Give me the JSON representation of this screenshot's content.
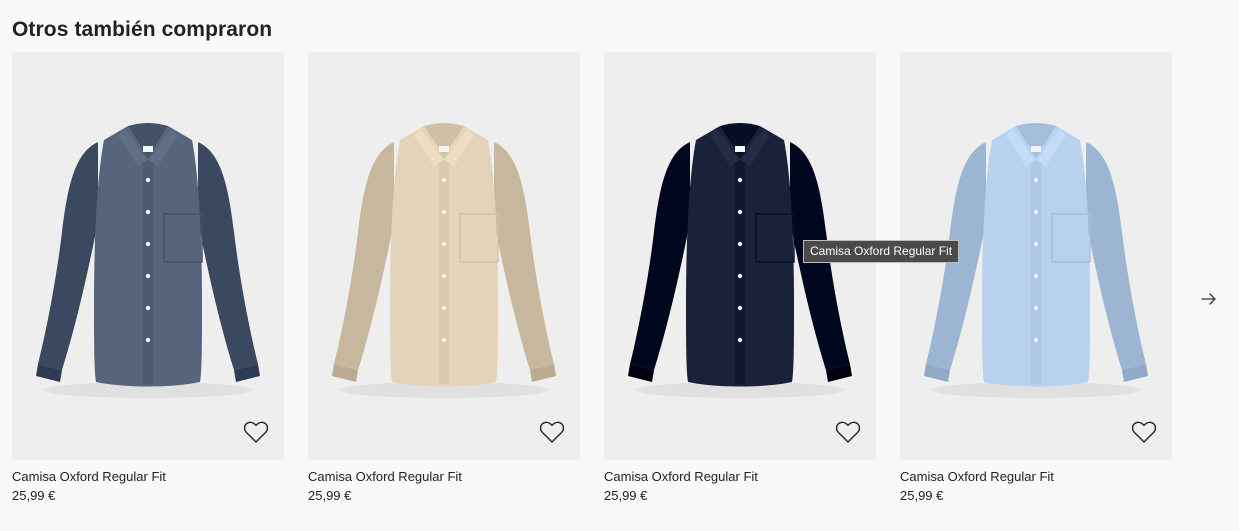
{
  "section": {
    "title": "Otros también compraron"
  },
  "products": [
    {
      "name": "Camisa Oxford Regular Fit",
      "price": "25,99 €",
      "color": "#56647c"
    },
    {
      "name": "Camisa Oxford Regular Fit",
      "price": "25,99 €",
      "color": "#e3d4b9"
    },
    {
      "name": "Camisa Oxford Regular Fit",
      "price": "25,99 €",
      "color": "#1a223a"
    },
    {
      "name": "Camisa Oxford Regular Fit",
      "price": "25,99 €",
      "color": "#b7d1ef"
    }
  ],
  "icons": {
    "favorite": "heart-icon",
    "next": "arrow-right-icon"
  },
  "tooltip": {
    "text": "Camisa Oxford Regular Fit"
  }
}
